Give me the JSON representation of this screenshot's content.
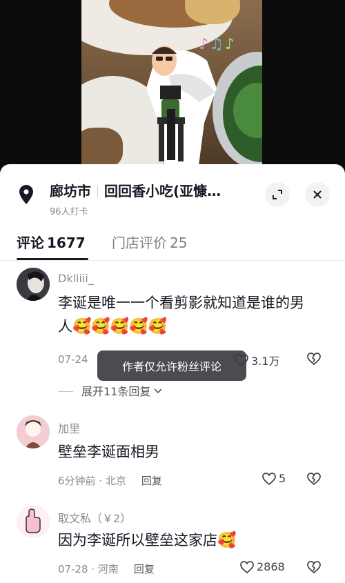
{
  "location": {
    "city": "廊坊市",
    "store": "回回香小吃(亚慷…",
    "checkins": "96人打卡"
  },
  "tabs": [
    {
      "label": "评论",
      "count": "1677",
      "active": true
    },
    {
      "label": "门店评价",
      "count": "25",
      "active": false
    }
  ],
  "comments": [
    {
      "username": "Dkliiii_",
      "text": "李诞是唯一一个看剪影就知道是谁的男人",
      "emoji": "🥰🥰🥰🥰🥰",
      "date": "07-24",
      "likes": "3.1万",
      "expand_label": "展开11条回复"
    },
    {
      "username": "加里",
      "text": "壁垒李诞面相男",
      "emoji": "",
      "meta": "6分钟前 · 北京",
      "reply_label": "回复",
      "likes": "5"
    },
    {
      "username": "取文私（￥2）",
      "text": "因为李诞所以壁垒这家店",
      "emoji": "🥰",
      "meta": "07-28 · 河南",
      "reply_label": "回复",
      "likes": "2868"
    }
  ],
  "toast": "作者仅允许粉丝评论",
  "icons": {
    "location": "map-pin-icon",
    "expand": "expand-icon",
    "close": "close-icon",
    "like": "heart-icon",
    "dislike": "broken-heart-icon"
  }
}
